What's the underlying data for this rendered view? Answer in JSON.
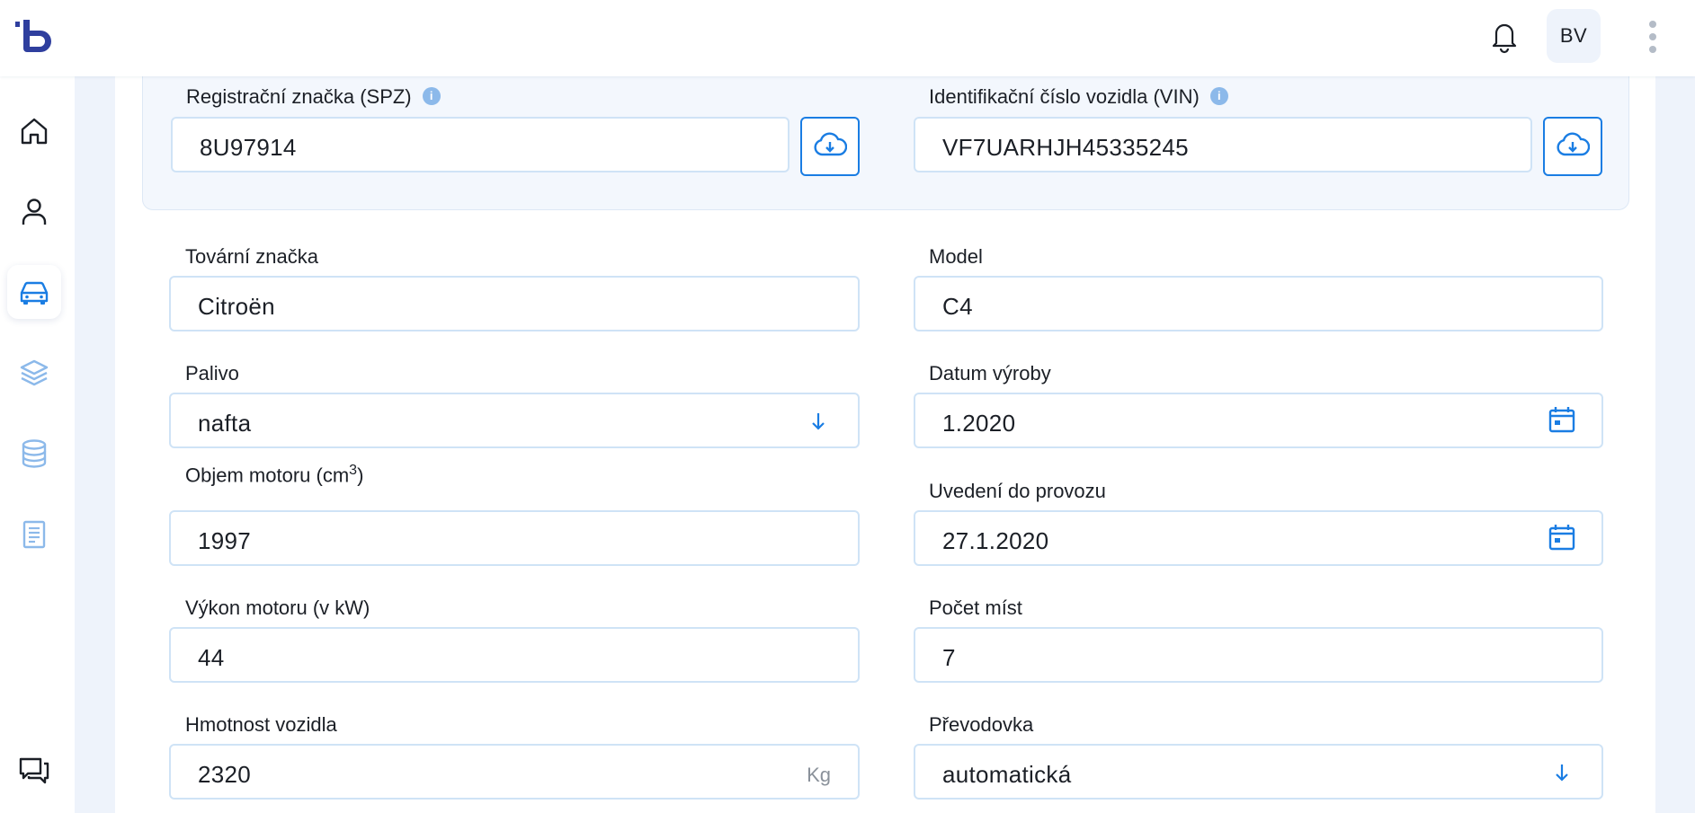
{
  "header": {
    "avatar_initials": "BV",
    "icons": [
      "app-logo",
      "bell-icon",
      "kebab-menu-icon"
    ]
  },
  "sidebar": {
    "items": [
      {
        "name": "home",
        "icon": "home-icon",
        "active": false
      },
      {
        "name": "user",
        "icon": "user-icon",
        "active": false
      },
      {
        "name": "car",
        "icon": "car-icon",
        "active": true
      },
      {
        "name": "layers",
        "icon": "layers-icon",
        "active": false
      },
      {
        "name": "database",
        "icon": "database-icon",
        "active": false
      },
      {
        "name": "document",
        "icon": "document-icon",
        "active": false
      }
    ],
    "bottom_icon": "chat-icon"
  },
  "identification": {
    "spz": {
      "label": "Registrační značka (SPZ)",
      "value": "8U97914"
    },
    "vin": {
      "label": "Identifikační číslo vozidla (VIN)",
      "value": "VF7UARHJH45335245"
    }
  },
  "form": {
    "brand": {
      "label": "Tovární značka",
      "value": "Citroën"
    },
    "model": {
      "label": "Model",
      "value": "C4"
    },
    "fuel": {
      "label": "Palivo",
      "value": "nafta"
    },
    "production_date": {
      "label": "Datum výroby",
      "value": "1.2020"
    },
    "engine_volume": {
      "label_prefix": "Objem motoru (cm",
      "label_sup": "3",
      "label_suffix": ")",
      "value": "1997"
    },
    "registration_date": {
      "label": "Uvedení do provozu",
      "value": "27.1.2020"
    },
    "engine_power": {
      "label": "Výkon motoru (v kW)",
      "value": "44"
    },
    "seats": {
      "label": "Počet míst",
      "value": "7"
    },
    "weight": {
      "label": "Hmotnost vozidla",
      "value": "2320",
      "unit": "Kg"
    },
    "transmission": {
      "label": "Převodovka",
      "value": "automatická"
    }
  },
  "colors": {
    "accent": "#1a7de3",
    "brand_logo": "#2f3f9e",
    "field_border": "#cfe3f6",
    "page_bg": "#eef3fb"
  }
}
